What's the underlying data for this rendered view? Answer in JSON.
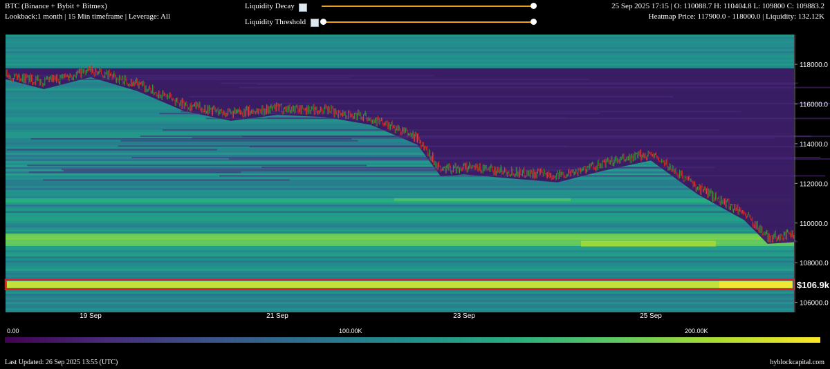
{
  "header": {
    "title": "BTC (Binance + Bybit + Bitmex)",
    "subtitle": "Lookback:1 month | 15 Min timeframe | Leverage: All",
    "ohlc": "25 Sep 2025 17:15 | O: 110088.7 H: 110404.8 L: 109800 C: 109883.2",
    "heatmap_info": "Heatmap Price: 117900.0 - 118000.0 | Liquidity: 132.12K"
  },
  "controls": {
    "decay_label": "Liquidity Decay",
    "threshold_label": "Liquidity Threshold"
  },
  "colors": {
    "slider": "#f0a020",
    "highlight": "#e02020",
    "candle_up": "#2e9a3e",
    "candle_down": "#d42020"
  },
  "chart_data": {
    "type": "heatmap",
    "x_tick_labels": [
      "19 Sep",
      "21 Sep",
      "23 Sep",
      "25 Sep"
    ],
    "y_tick_labels": [
      "118000.0",
      "116000.0",
      "114000.0",
      "112000.0",
      "110000.0",
      "108000.0",
      "106000.0"
    ],
    "ylim": [
      105500,
      119500
    ],
    "highlight_label": "$106.9k",
    "highlight_price": 106900,
    "price_path": [
      {
        "date": "2025-09-18T00:00",
        "price": 117600
      },
      {
        "date": "2025-09-18T12:00",
        "price": 117100
      },
      {
        "date": "2025-09-19T00:00",
        "price": 117700
      },
      {
        "date": "2025-09-19T12:00",
        "price": 117000
      },
      {
        "date": "2025-09-20T00:00",
        "price": 116000
      },
      {
        "date": "2025-09-20T12:00",
        "price": 115500
      },
      {
        "date": "2025-09-21T00:00",
        "price": 115800
      },
      {
        "date": "2025-09-21T12:00",
        "price": 115700
      },
      {
        "date": "2025-09-22T00:00",
        "price": 115300
      },
      {
        "date": "2025-09-22T12:00",
        "price": 114300
      },
      {
        "date": "2025-09-22T18:00",
        "price": 112700
      },
      {
        "date": "2025-09-23T00:00",
        "price": 112800
      },
      {
        "date": "2025-09-23T12:00",
        "price": 112600
      },
      {
        "date": "2025-09-24T00:00",
        "price": 112400
      },
      {
        "date": "2025-09-24T12:00",
        "price": 113000
      },
      {
        "date": "2025-09-25T00:00",
        "price": 113500
      },
      {
        "date": "2025-09-25T12:00",
        "price": 111800
      },
      {
        "date": "2025-09-26T00:00",
        "price": 110500
      },
      {
        "date": "2025-09-26T06:00",
        "price": 109300
      },
      {
        "date": "2025-09-26T13:55",
        "price": 109400
      }
    ],
    "colorbar_ticks": [
      "0.00",
      "100.00K",
      "200.00K"
    ],
    "colorbar_range": [
      0,
      240000
    ]
  },
  "footer": {
    "last_updated": "Last Updated: 26 Sep 2025 13:55 (UTC)",
    "brand": "hyblockcapital.com"
  }
}
